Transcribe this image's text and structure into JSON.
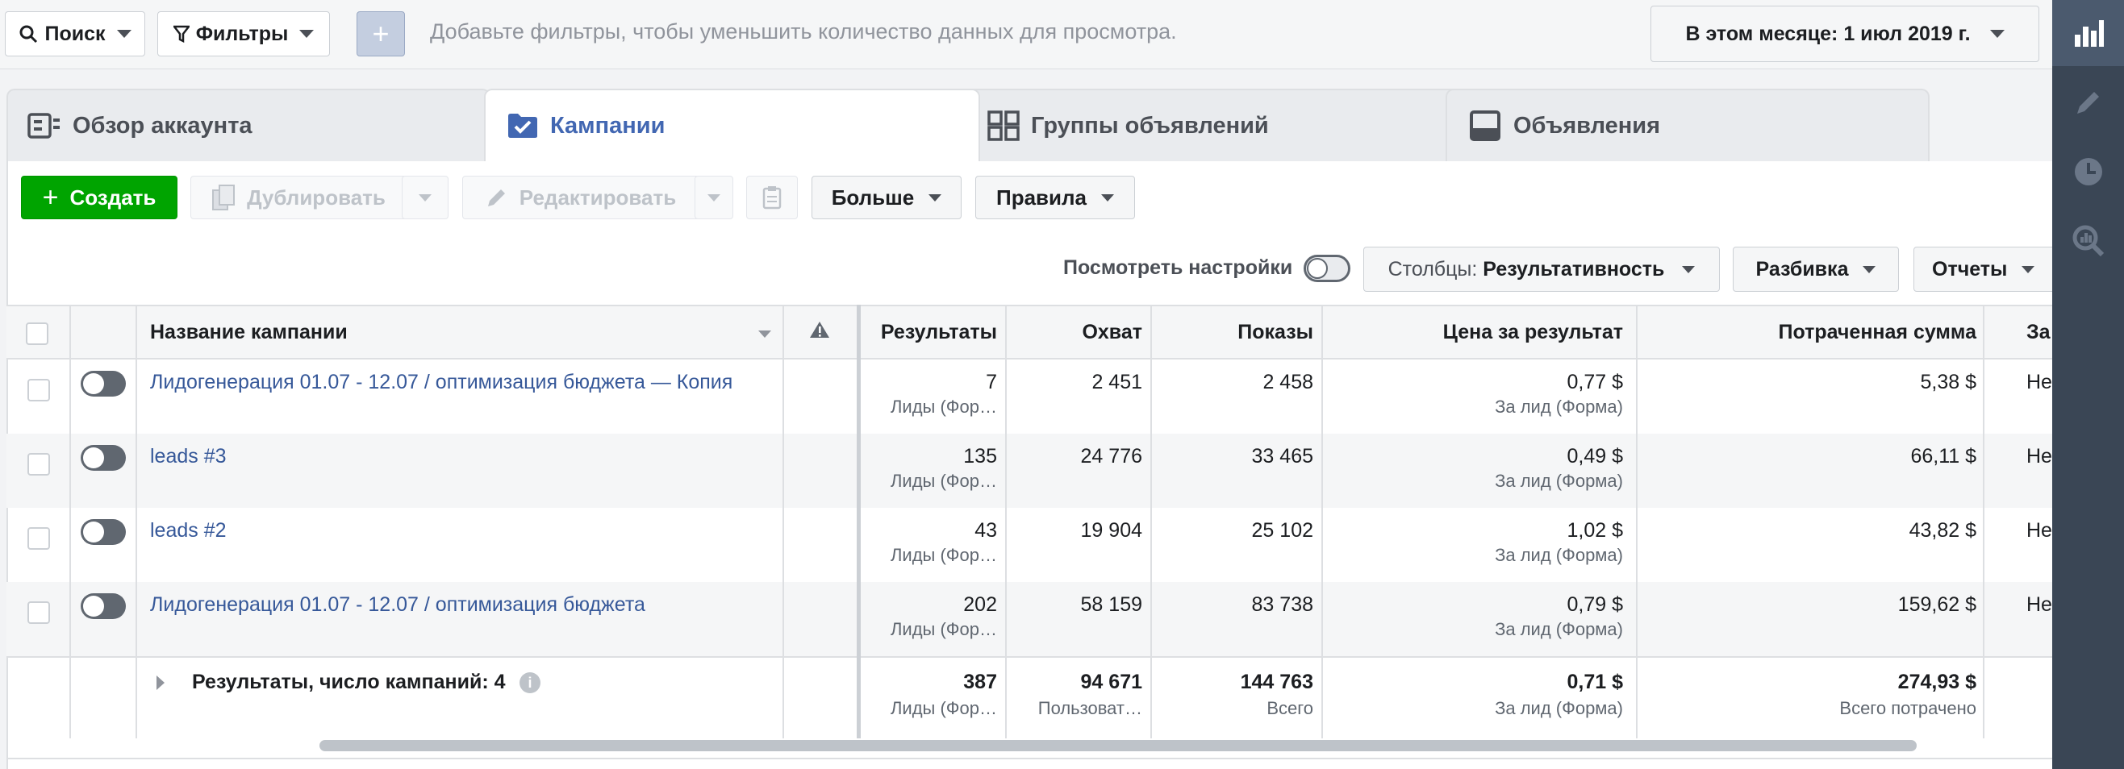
{
  "topbar": {
    "search_label": "Поиск",
    "filters_label": "Фильтры",
    "add_label": "+",
    "hint": "Добавьте фильтры, чтобы уменьшить количество данных для просмотра.",
    "date_label": "В этом месяце: 1 июл 2019 г."
  },
  "tabs": [
    {
      "label": "Обзор аккаунта",
      "icon": "account-overview-icon"
    },
    {
      "label": "Кампании",
      "icon": "campaigns-folder-icon",
      "active": true
    },
    {
      "label": "Группы объявлений",
      "icon": "adsets-grid-icon"
    },
    {
      "label": "Объявления",
      "icon": "ads-icon"
    }
  ],
  "toolbar": {
    "create_label": "Создать",
    "duplicate_label": "Дублировать",
    "edit_label": "Редактировать",
    "more_label": "Больше",
    "rules_label": "Правила",
    "view_settings_label": "Посмотреть настройки",
    "columns_prefix": "Столбцы:",
    "columns_value": "Результативность",
    "breakdown_label": "Разбивка",
    "reports_label": "Отчеты"
  },
  "table": {
    "headers": {
      "name": "Название кампании",
      "results": "Результаты",
      "reach": "Охват",
      "impressions": "Показы",
      "cost": "Цена за результат",
      "spent": "Потраченная сумма",
      "end": "За"
    },
    "rows": [
      {
        "name": "Лидогенерация 01.07 - 12.07 / оптимизация бюджета — Копия",
        "results": "7",
        "results_sub": "Лиды (Фор…",
        "reach": "2 451",
        "impressions": "2 458",
        "cost": "0,77 $",
        "cost_sub": "За лид (Форма)",
        "spent": "5,38 $",
        "end": "Не"
      },
      {
        "name": "leads #3",
        "results": "135",
        "results_sub": "Лиды (Фор…",
        "reach": "24 776",
        "impressions": "33 465",
        "cost": "0,49 $",
        "cost_sub": "За лид (Форма)",
        "spent": "66,11 $",
        "end": "Не"
      },
      {
        "name": "leads #2",
        "results": "43",
        "results_sub": "Лиды (Фор…",
        "reach": "19 904",
        "impressions": "25 102",
        "cost": "1,02 $",
        "cost_sub": "За лид (Форма)",
        "spent": "43,82 $",
        "end": "Не"
      },
      {
        "name": "Лидогенерация 01.07 - 12.07 / оптимизация бюджета",
        "results": "202",
        "results_sub": "Лиды (Фор…",
        "reach": "58 159",
        "impressions": "83 738",
        "cost": "0,79 $",
        "cost_sub": "За лид (Форма)",
        "spent": "159,62 $",
        "end": "Не"
      }
    ],
    "totals": {
      "label": "Результаты, число кампаний: 4",
      "results": "387",
      "results_sub": "Лиды (Фор…",
      "reach": "94 671",
      "reach_sub": "Пользоват…",
      "impressions": "144 763",
      "impressions_sub": "Всего",
      "cost": "0,71 $",
      "cost_sub": "За лид (Форма)",
      "spent": "274,93 $",
      "spent_sub": "Всего потрачено"
    }
  },
  "colors": {
    "accent": "#4267b2",
    "create": "#00a400",
    "link": "#365899",
    "rail": "#3a4655"
  }
}
